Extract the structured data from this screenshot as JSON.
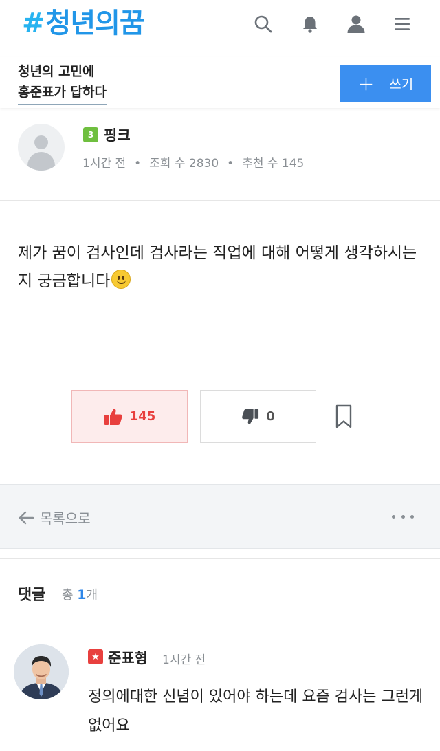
{
  "header": {
    "logo_text": "청년의꿈",
    "logo_hash": "#",
    "icons": [
      "search-icon",
      "bell-icon",
      "user-icon",
      "menu-icon"
    ],
    "accent_color": "#2196e8"
  },
  "sub_header": {
    "title_line1": "청년의 고민에",
    "title_line2": "홍준표가 답하다",
    "write_plus": "+",
    "write_label": "쓰기",
    "write_color": "#3b8ff0"
  },
  "post": {
    "level": "3",
    "author": "핑크",
    "time": "1시간 전",
    "views": "조회 수 2830",
    "recommends": "추천 수 145",
    "sep": "•",
    "body": "제가 꿈이 검사인데 검사라는 직업에 대해 어떻게 생각하시는지 궁금합니다",
    "emoji": "smiley-icon",
    "likes": "145",
    "dislikes": "0"
  },
  "nav": {
    "back_label": "목록으로",
    "more_icon": "more-icon"
  },
  "comments": {
    "title": "댓글",
    "count_prefix": "총",
    "count": "1",
    "count_suffix": "개",
    "items": [
      {
        "author": "준표형",
        "badge": "★",
        "time": "1시간 전",
        "text": "정의에대한 신념이 있어야 하는데 요즘 검사는 그런게 없어요"
      }
    ]
  }
}
